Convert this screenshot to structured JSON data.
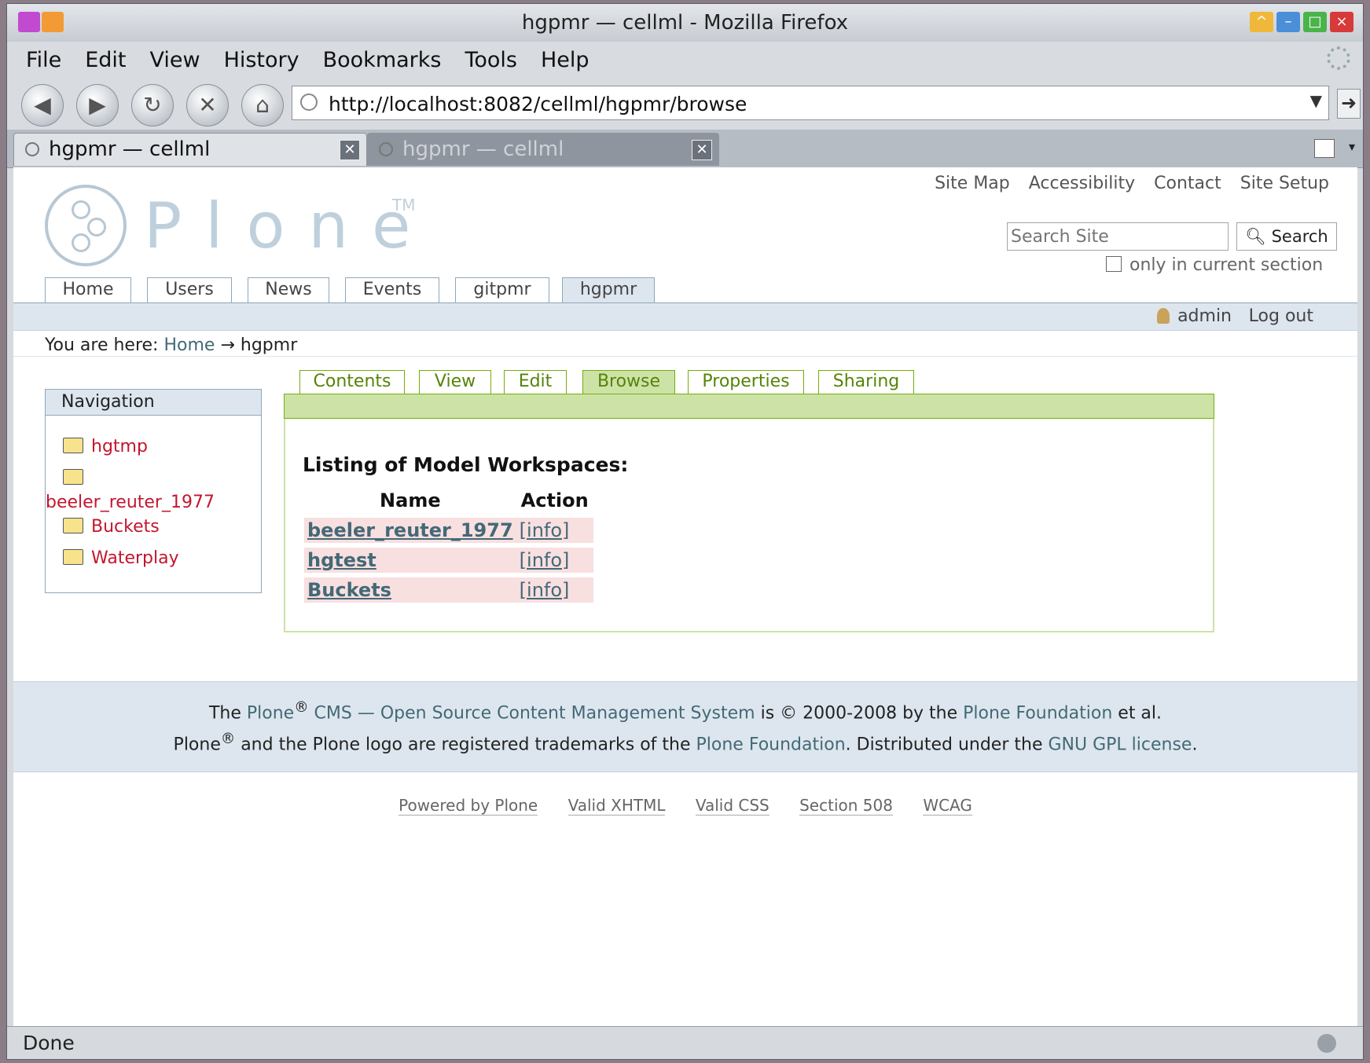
{
  "window": {
    "title": "hgpmr — cellml - Mozilla Firefox"
  },
  "menubar": [
    "File",
    "Edit",
    "View",
    "History",
    "Bookmarks",
    "Tools",
    "Help"
  ],
  "navbar": {
    "url": "http://localhost:8082/cellml/hgpmr/browse",
    "buttons": [
      "back-icon",
      "forward-icon",
      "reload-icon",
      "stop-icon",
      "home-icon"
    ]
  },
  "tabs": [
    {
      "label": "hgpmr — cellml",
      "active": true
    },
    {
      "label": "hgpmr — cellml",
      "active": false
    }
  ],
  "site": {
    "logo_text": "Plone",
    "logo_tm": "TM",
    "actions": [
      "Site Map",
      "Accessibility",
      "Contact",
      "Site Setup"
    ],
    "search_placeholder": "Search Site",
    "search_button": "Search",
    "only_section": "only in current section",
    "portal_tabs": [
      "Home",
      "Users",
      "News",
      "Events",
      "gitpmr",
      "hgpmr"
    ],
    "selected_tab": "hgpmr",
    "user": "admin",
    "logout": "Log out"
  },
  "breadcrumb": {
    "prefix": "You are here:",
    "home": "Home",
    "arrow": "→",
    "current": "hgpmr"
  },
  "navigation": {
    "title": "Navigation",
    "items": [
      "hgtmp",
      "beeler_reuter_1977",
      "Buckets",
      "Waterplay"
    ]
  },
  "content_views": [
    "Contents",
    "View",
    "Edit",
    "Browse",
    "Properties",
    "Sharing"
  ],
  "listing": {
    "title": "Listing of Model Workspaces:",
    "headers": [
      "Name",
      "Action"
    ],
    "rows": [
      {
        "name": "beeler_reuter_1977",
        "action": "[info]"
      },
      {
        "name": "hgtest",
        "action": "[info]"
      },
      {
        "name": "Buckets",
        "action": "[info]"
      }
    ]
  },
  "footer": {
    "l1_the": "The",
    "l1_plone": "Plone",
    "l1_cms": "CMS — Open Source Content Management System",
    "l1_is": "is",
    "l1_copy": "©",
    "l1_years": "2000-2008 by the",
    "l1_foundation": "Plone Foundation",
    "l1_etal": "et al.",
    "l2_plone": "Plone",
    "l2_mid": "and the Plone logo are registered trademarks of the",
    "l2_foundation": "Plone Foundation",
    "l2_dist": ". Distributed under the",
    "l2_gpl": "GNU GPL license",
    "l2_end": ".",
    "reg": "®"
  },
  "colophon": [
    "Powered by Plone",
    "Valid XHTML",
    "Valid CSS",
    "Section 508",
    "WCAG"
  ],
  "status": "Done"
}
